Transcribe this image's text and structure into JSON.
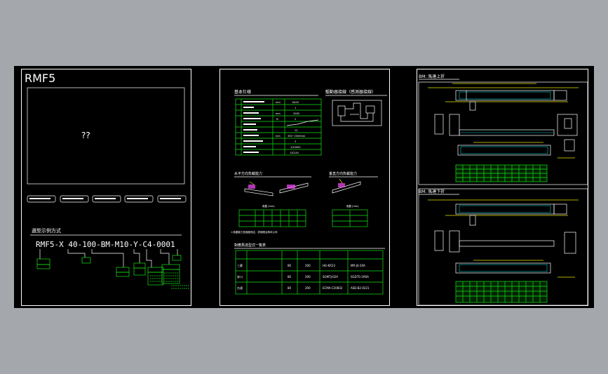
{
  "sheet1": {
    "title": "RMF5",
    "preview_text": "??",
    "section_title": "選型示例方式",
    "model_code": "RMF5-X 40-100-BM-M10-Y-C4-0001",
    "code_parts": [
      "RMF5",
      "X",
      "40",
      "100",
      "BM",
      "M10",
      "Y",
      "C4",
      "0001"
    ]
  },
  "sheet2": {
    "spec_title": "基本仕様",
    "circuit_title": "驅動器接線（感測器接線）",
    "spec_rows": [
      {
        "label": "",
        "unit": "mm",
        "value": "16/20"
      },
      {
        "label": "",
        "unit": "",
        "value": "1"
      },
      {
        "label": "",
        "unit": "mm",
        "value": "2000"
      },
      {
        "label": "",
        "unit": "N",
        "value": "2"
      },
      {
        "label": "",
        "unit": "",
        "value": ""
      },
      {
        "label": "",
        "unit": "",
        "value": "12"
      },
      {
        "label": "",
        "unit": "mm",
        "value": "300~2000mm"
      },
      {
        "label": "",
        "unit": "",
        "value": "3"
      },
      {
        "label": "",
        "unit": "",
        "value": "1/10000"
      },
      {
        "label": "",
        "unit": "",
        "value": "DC24V"
      }
    ],
    "load_h_title": "水平方向負載能力",
    "load_v_title": "垂直方向負載能力",
    "load_table_header": "負載 (mm)",
    "note": "＊負載能力依速度而定，詳細請洽詢本公司",
    "motor_title": "對應馬達型式一覧表",
    "motor_rows": [
      {
        "name": "三菱",
        "c1": "80",
        "c2": "200",
        "c3": "HG-KR23",
        "c4": "MR-J4-20A"
      },
      {
        "name": "安川",
        "c1": "80",
        "c2": "200",
        "c3": "SGM7J-02A",
        "c4": "SGD7S-1R6A"
      },
      {
        "name": "台達",
        "c1": "80",
        "c2": "200",
        "c3": "ECMA-C20602",
        "c4": "ASD-B2-0221"
      }
    ]
  },
  "sheet3": {
    "top_title": "BM: 馬達上折",
    "bottom_title": "BM: 馬達下折"
  }
}
